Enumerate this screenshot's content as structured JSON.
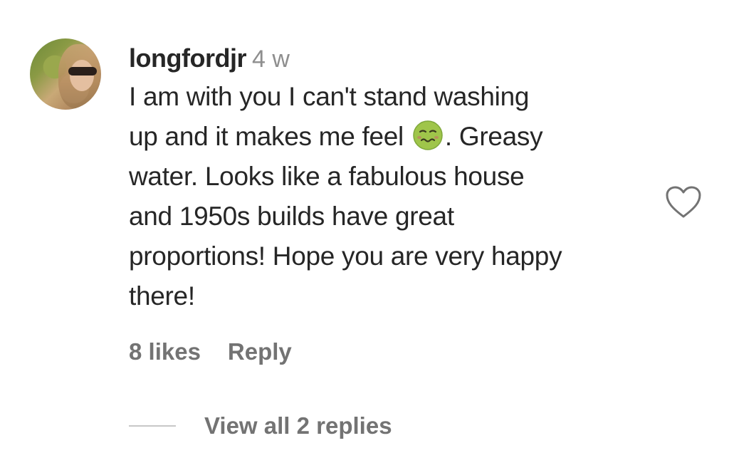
{
  "comment": {
    "username": "longfordjr",
    "time": "4 w",
    "body_lines": [
      {
        "before": "I am with you I can't stand washing"
      },
      {
        "before": "up and it makes me feel ",
        "emoji": "nauseated-face",
        "after": ". Greasy"
      },
      {
        "before": "water. Looks like a fabulous house"
      },
      {
        "before": "and 1950s builds have great"
      },
      {
        "before": "proportions! Hope you are very happy"
      },
      {
        "before": "there!"
      }
    ],
    "likes_label": "8 likes",
    "reply_label": "Reply",
    "view_replies_label": "View all 2 replies",
    "like_icon": "heart-outline-icon"
  },
  "colors": {
    "text_primary": "#262626",
    "text_secondary": "#737373",
    "timestamp": "#8e8e8e",
    "divider": "#c7c7c7"
  }
}
